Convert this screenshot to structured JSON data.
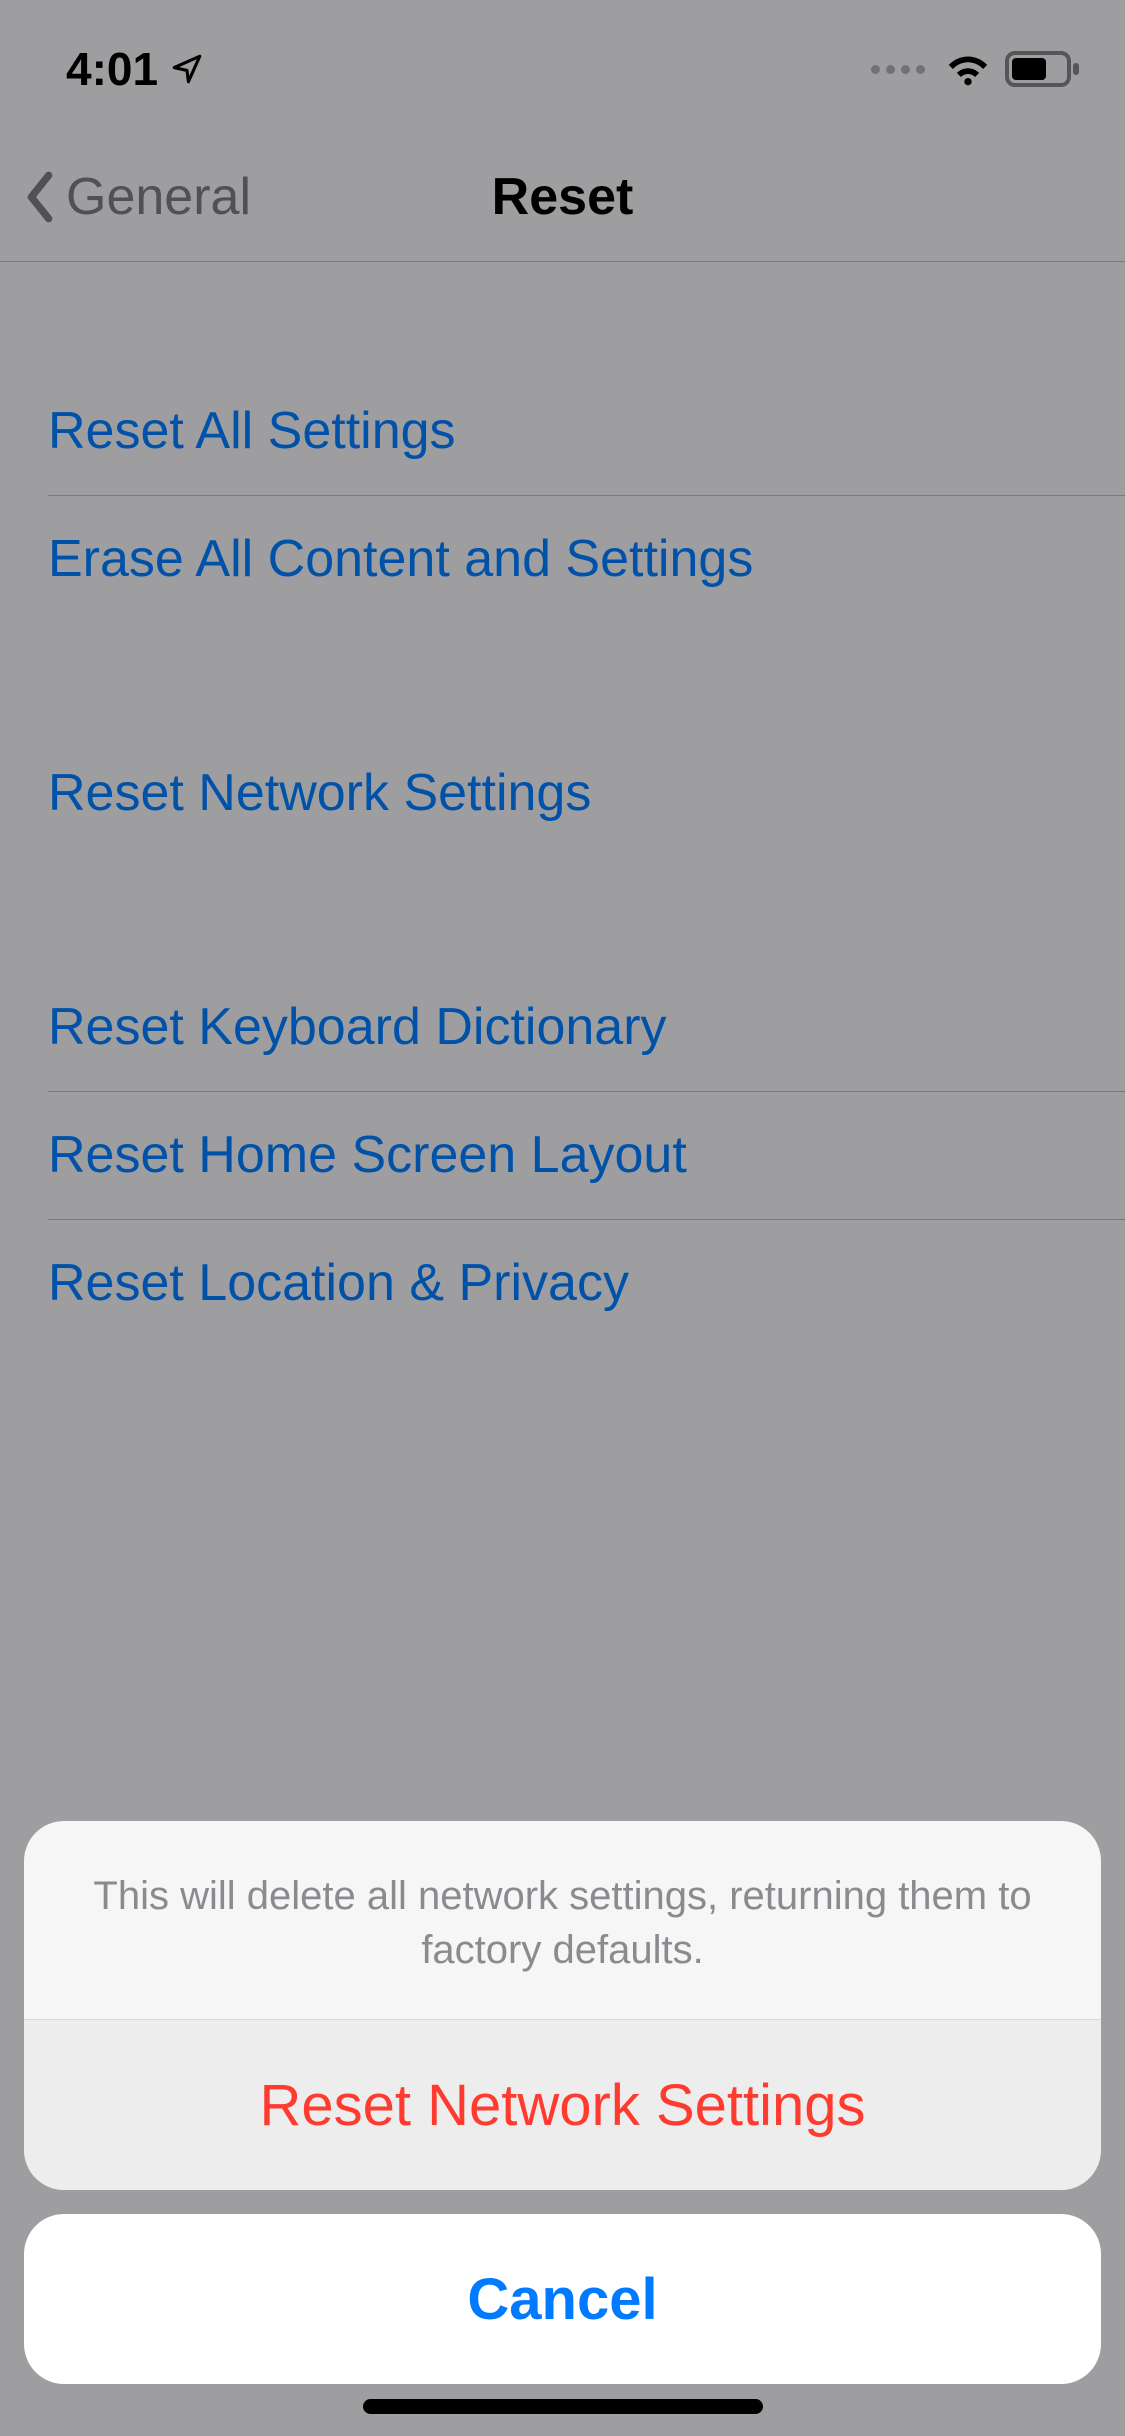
{
  "status": {
    "time": "4:01"
  },
  "nav": {
    "back_label": "General",
    "title": "Reset"
  },
  "group1": {
    "items": [
      {
        "label": "Reset All Settings"
      },
      {
        "label": "Erase All Content and Settings"
      }
    ]
  },
  "group2": {
    "items": [
      {
        "label": "Reset Network Settings"
      }
    ]
  },
  "group3": {
    "items": [
      {
        "label": "Reset Keyboard Dictionary"
      },
      {
        "label": "Reset Home Screen Layout"
      },
      {
        "label": "Reset Location & Privacy"
      }
    ]
  },
  "sheet": {
    "message": "This will delete all network settings, returning them to factory defaults.",
    "action": "Reset Network Settings",
    "cancel": "Cancel"
  }
}
